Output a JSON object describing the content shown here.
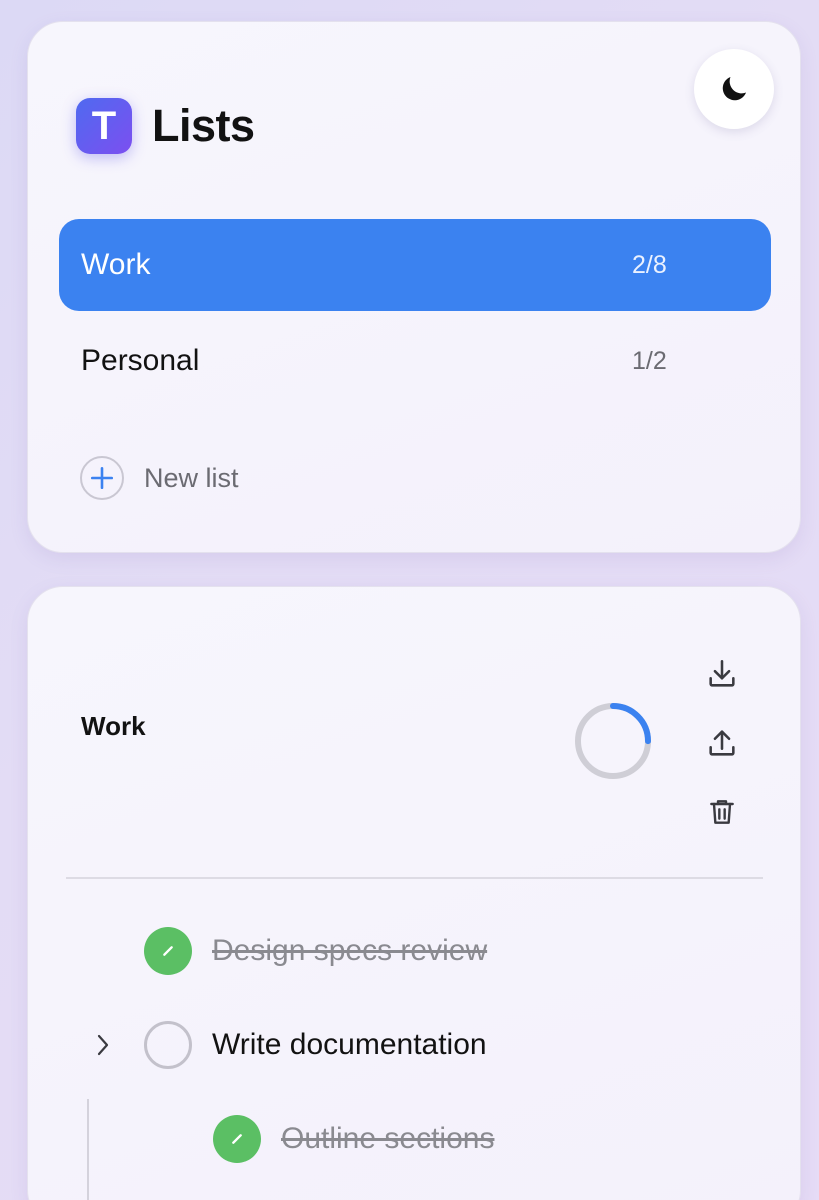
{
  "brand": {
    "logo_letter": "T",
    "title": "Lists"
  },
  "theme_toggle": {
    "icon": "moon-icon"
  },
  "lists": [
    {
      "label": "Work",
      "count": "2/8",
      "active": true
    },
    {
      "label": "Personal",
      "count": "1/2",
      "active": false
    }
  ],
  "new_list": {
    "label": "New list",
    "icon": "plus-icon"
  },
  "current_list": {
    "title": "Work",
    "progress": 0.25,
    "actions": [
      "download-icon",
      "upload-icon",
      "trash-icon"
    ]
  },
  "tasks": [
    {
      "label": "Design specs review",
      "done": true,
      "level": 0
    },
    {
      "label": "Write documentation",
      "done": false,
      "level": 0,
      "has_children": true
    },
    {
      "label": "Outline sections",
      "done": true,
      "level": 1
    }
  ],
  "colors": {
    "accent": "#3b82f0",
    "done_green": "#5bbf64",
    "logo_gradient_start": "#4f6af0",
    "logo_gradient_end": "#7c4ff0"
  }
}
